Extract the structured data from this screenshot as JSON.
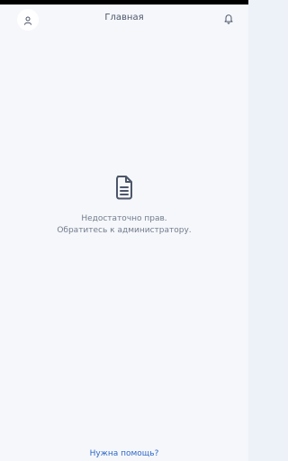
{
  "header": {
    "title": "Главная",
    "profile_icon": "profile-icon",
    "notifications_icon": "bell-icon"
  },
  "empty_state": {
    "icon": "document-icon",
    "message": "Недостаточно прав. Обратитесь к администратору."
  },
  "footer": {
    "help_link": "Нужна помощь?"
  },
  "colors": {
    "background": "#f5f7fb",
    "side_background": "#eef2f8",
    "link": "#2e67c7",
    "icon": "#4d5669",
    "message": "#737c8c"
  }
}
